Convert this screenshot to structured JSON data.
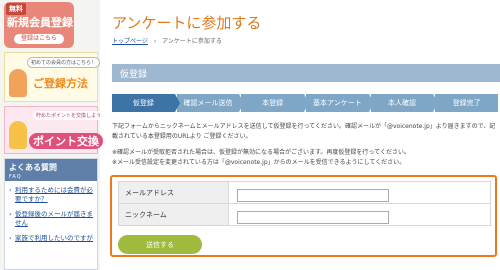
{
  "sidebar": {
    "register_banner": {
      "tag": "無料",
      "title": "新規会員登録",
      "link": "登録はこちら"
    },
    "howto_banner": {
      "note": "初めての会員の方はこちら！",
      "title": "ご登録方法"
    },
    "points_banner": {
      "note": "貯めたポイントを交換しよう",
      "title": "ポイント交換"
    },
    "faq": {
      "title": "よくある質問",
      "subtitle": "FAQ",
      "items": [
        "利用するためには会費が必要ですか？",
        "仮登録後のメールが届きません",
        "家族で利用したいのですが"
      ]
    }
  },
  "main": {
    "title": "アンケートに参加する",
    "breadcrumb": {
      "home": "トップページ",
      "sep": "›",
      "current": "アンケートに参加する"
    },
    "section_title": "仮登録",
    "steps": [
      "仮登録",
      "確認メール送信",
      "本登録",
      "基本アンケート",
      "本人確認",
      "登録完了"
    ],
    "intro": "下記フォームからニックネームとメールアドレスを送信して仮登録を行ってください。確認メールが「@voicenote.jp」より届きますので、記載されている本登録用のURLより ご登録ください。",
    "notes": [
      "※確認メールが受取拒否された場合は、仮登録が無効になる場合がございます。再度仮登録を行ってください。",
      "※メール受信設定を変更されている方は「@voicenote.jp」からのメールを受信できるようにしてください。"
    ],
    "form": {
      "email_label": "メールアドレス",
      "email_value": "",
      "nickname_label": "ニックネーム",
      "nickname_value": "",
      "submit_label": "送信する"
    }
  },
  "colors": {
    "accent": "#e07a1a",
    "step_active": "#3e73a6",
    "step": "#7ea7c7",
    "submit": "#9fba3c",
    "form_border": "#ec7a1c"
  }
}
